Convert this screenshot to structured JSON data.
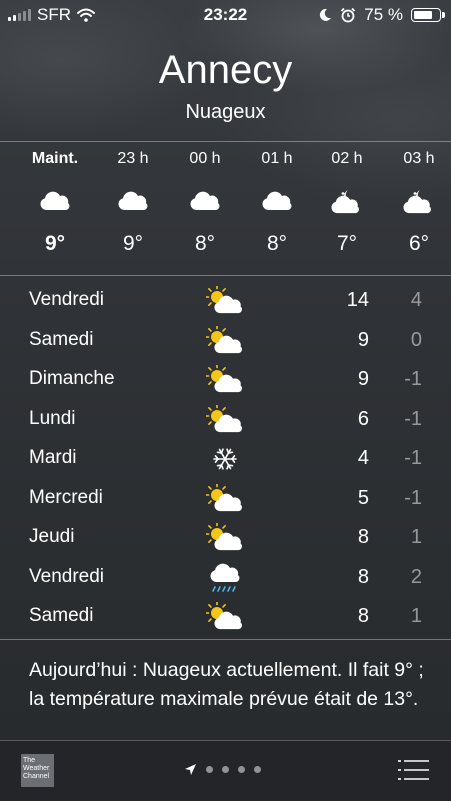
{
  "status_bar": {
    "carrier": "SFR",
    "time": "23:22",
    "battery": "75 %",
    "icons": [
      "signal-icon",
      "wifi-icon",
      "moon-icon",
      "alarm-icon",
      "battery-icon"
    ]
  },
  "location": {
    "city": "Annecy",
    "condition": "Nuageux"
  },
  "hourly": [
    {
      "time": "Maint.",
      "icon": "cloud",
      "temp": "9°"
    },
    {
      "time": "23 h",
      "icon": "cloud",
      "temp": "9°"
    },
    {
      "time": "00 h",
      "icon": "cloud",
      "temp": "8°"
    },
    {
      "time": "01 h",
      "icon": "cloud",
      "temp": "8°"
    },
    {
      "time": "02 h",
      "icon": "moon-cloud",
      "temp": "7°"
    },
    {
      "time": "03 h",
      "icon": "moon-cloud",
      "temp": "6°"
    }
  ],
  "daily": [
    {
      "day": "Vendredi",
      "icon": "sun-cloud",
      "high": "14",
      "low": "4"
    },
    {
      "day": "Samedi",
      "icon": "sun-cloud",
      "high": "9",
      "low": "0"
    },
    {
      "day": "Dimanche",
      "icon": "sun-cloud",
      "high": "9",
      "low": "-1"
    },
    {
      "day": "Lundi",
      "icon": "sun-cloud",
      "high": "6",
      "low": "-1"
    },
    {
      "day": "Mardi",
      "icon": "snowflake",
      "high": "4",
      "low": "-1"
    },
    {
      "day": "Mercredi",
      "icon": "sun-cloud",
      "high": "5",
      "low": "-1"
    },
    {
      "day": "Jeudi",
      "icon": "sun-cloud",
      "high": "8",
      "low": "1"
    },
    {
      "day": "Vendredi",
      "icon": "rain-cloud",
      "high": "8",
      "low": "2"
    },
    {
      "day": "Samedi",
      "icon": "sun-cloud",
      "high": "8",
      "low": "1"
    }
  ],
  "summary": "Aujourd’hui : Nuageux actuellement. Il fait 9° ; la température maximale prévue était de 13°.",
  "toolbar": {
    "logo_text": "The Weather Channel",
    "page_count": 5,
    "current_page": 0
  },
  "colors": {
    "sun": "#f5c518",
    "rain": "#4fb3e8",
    "low_temp": "#9a9c9f"
  }
}
